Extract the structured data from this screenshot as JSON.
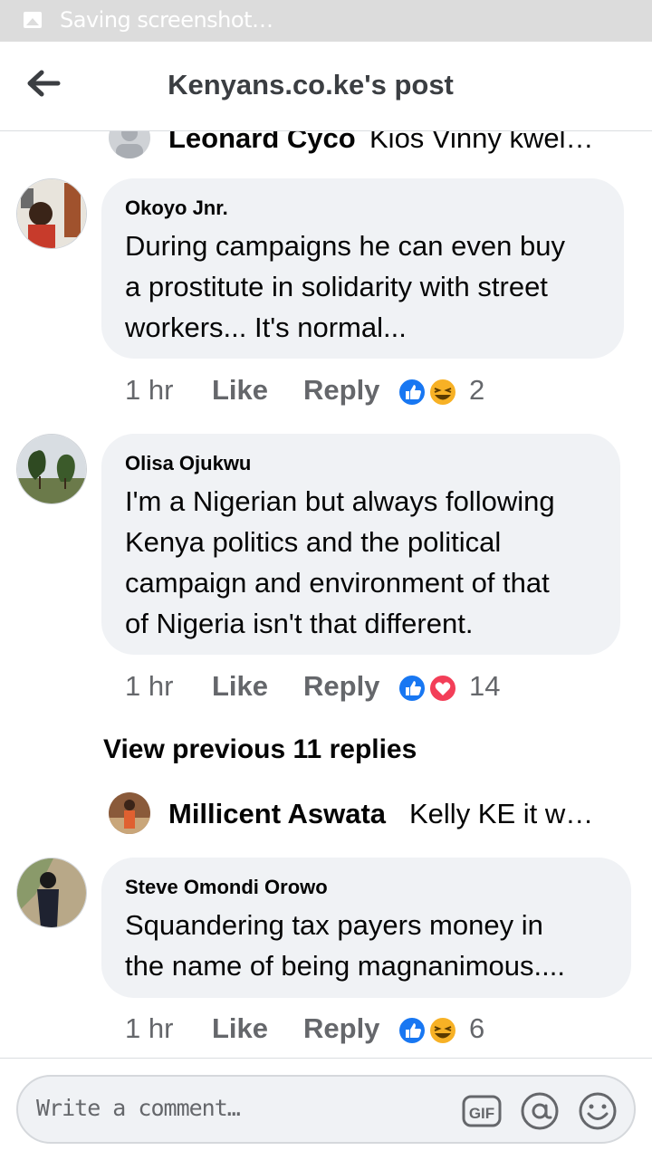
{
  "status_bar": {
    "text": "Saving screenshot…",
    "icon": "image-icon"
  },
  "header": {
    "title": "Kenyans.co.ke's post",
    "back_icon": "back-arrow-icon"
  },
  "reply_previews": [
    {
      "name": "Leonard Cyco",
      "text": "Kios Vinny kwel…"
    },
    {
      "name": "Millicent Aswata",
      "text": "Kelly KE it w…"
    }
  ],
  "comments": [
    {
      "name": "Okoyo Jnr.",
      "text": [
        "During campaigns he can even buy",
        "a prostitute in solidarity with street",
        "workers... It's normal..."
      ],
      "time": "1 hr",
      "like": "Like",
      "reply": "Reply",
      "reactions": [
        "like",
        "haha"
      ],
      "count": "2"
    },
    {
      "name": "Olisa Ojukwu",
      "text": [
        "I'm a Nigerian but always following",
        "Kenya politics and the political",
        "campaign and environment of that",
        "of Nigeria isn't that different."
      ],
      "time": "1 hr",
      "like": "Like",
      "reply": "Reply",
      "reactions": [
        "like",
        "love"
      ],
      "count": "14"
    },
    {
      "name": "Steve Omondi Orowo",
      "text": [
        "Squandering tax payers money in",
        "the name of being magnanimous...."
      ],
      "time": "1 hr",
      "like": "Like",
      "reply": "Reply",
      "reactions": [
        "like",
        "haha"
      ],
      "count": "6"
    }
  ],
  "view_previous": "View previous 11 replies",
  "composer": {
    "placeholder": "Write a comment…",
    "gif_label": "GIF",
    "icons": [
      "gif-icon",
      "mention-icon",
      "emoji-icon"
    ]
  },
  "colors": {
    "like_blue": "#1877f2",
    "love_red": "#f33e58",
    "haha_yellow": "#f7b125",
    "bubble_bg": "#f0f2f5",
    "meta_gray": "#65676b"
  }
}
